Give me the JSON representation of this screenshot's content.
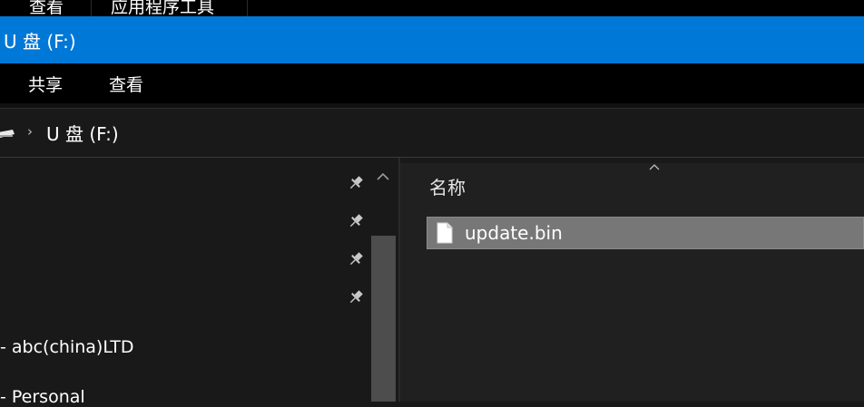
{
  "top_tabs": [
    {
      "label": "查看"
    },
    {
      "label": "应用程序工具"
    }
  ],
  "title_bar": {
    "title": "U 盘 (F:)"
  },
  "ribbon": {
    "tabs": [
      {
        "label": "共享"
      },
      {
        "label": "查看"
      }
    ]
  },
  "address_bar": {
    "path_icon": "usb-drive-icon",
    "separator_icon": "chevron-right-icon",
    "location": "U 盘 (F:)"
  },
  "nav_pane": {
    "pinned_count_visible": 4,
    "items": [
      {
        "label": "- abc(china)LTD"
      },
      {
        "label": "- Personal"
      }
    ]
  },
  "file_list": {
    "column_header": "名称",
    "files": [
      {
        "name": "update.bin",
        "icon": "file-icon",
        "selected": true
      }
    ]
  },
  "colors": {
    "accent": "#0078d7",
    "background": "#191919",
    "content_background": "#202020",
    "selection": "#777777"
  }
}
